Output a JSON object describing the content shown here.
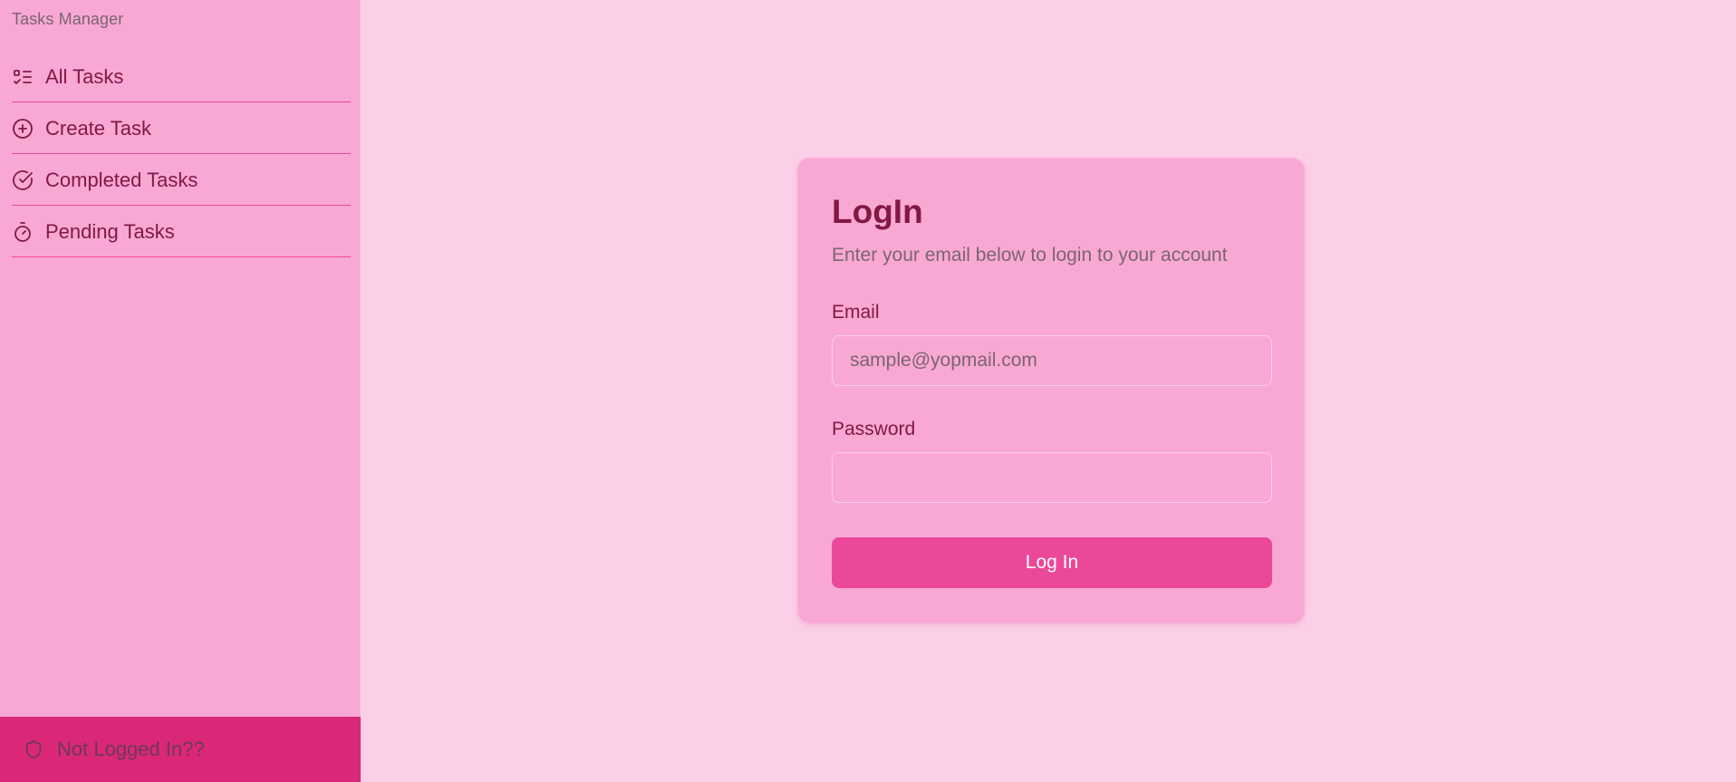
{
  "app": {
    "title": "Tasks Manager"
  },
  "sidebar": {
    "items": [
      {
        "label": "All Tasks",
        "icon": "list-checks-icon"
      },
      {
        "label": "Create Task",
        "icon": "plus-circle-icon"
      },
      {
        "label": "Completed Tasks",
        "icon": "check-circle-icon"
      },
      {
        "label": "Pending Tasks",
        "icon": "timer-icon"
      }
    ],
    "footer": {
      "label": "Not Logged In??",
      "icon": "shield-icon"
    }
  },
  "login": {
    "title": "LogIn",
    "subtitle": "Enter your email below to login to your account",
    "email_label": "Email",
    "email_placeholder": "sample@yopmail.com",
    "email_value": "",
    "password_label": "Password",
    "password_value": "",
    "button_label": "Log In"
  },
  "colors": {
    "page_background": "#fbcfe8",
    "sidebar_background": "#f9a8d4",
    "accent": "#ec4899",
    "footer_background": "#db2777",
    "text_primary": "#831843",
    "text_muted": "#7a6570"
  }
}
